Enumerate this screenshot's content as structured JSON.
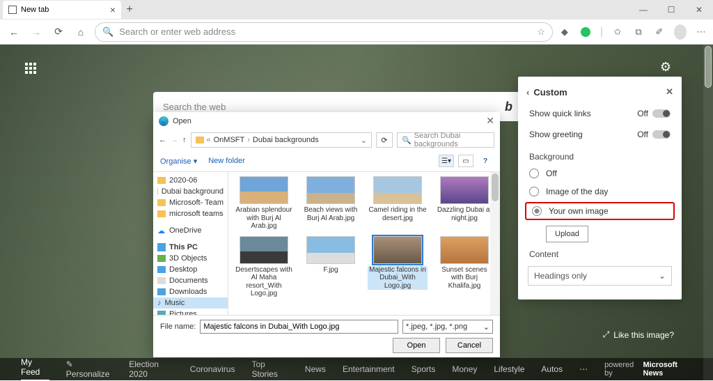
{
  "browser": {
    "tab_title": "New tab",
    "address_placeholder": "Search or enter web address"
  },
  "ntp": {
    "search_placeholder": "Search the web",
    "like_label": "Like this image?",
    "feed": [
      "My Feed",
      "Personalize",
      "Election 2020",
      "Coronavirus",
      "Top Stories",
      "News",
      "Entertainment",
      "Sports",
      "Money",
      "Lifestyle",
      "Autos"
    ],
    "powered": "powered by",
    "brand": "Microsoft News"
  },
  "panel": {
    "title": "Custom",
    "quick_links": {
      "label": "Show quick links",
      "state": "Off"
    },
    "greeting": {
      "label": "Show greeting",
      "state": "Off"
    },
    "background_label": "Background",
    "bg_off": "Off",
    "bg_image": "Image of the day",
    "bg_own": "Your own image",
    "upload": "Upload",
    "content_label": "Content",
    "content_value": "Headings only"
  },
  "dialog": {
    "title": "Open",
    "path": {
      "seg1": "OnMSFT",
      "seg2": "Dubai backgrounds",
      "prefix": "«"
    },
    "search_placeholder": "Search Dubai backgrounds",
    "organise": "Organise",
    "newfolder": "New folder",
    "tree": {
      "folders": [
        "2020-06",
        "Dubai background",
        "Microsoft- Team",
        "microsoft teams"
      ],
      "onedrive": "OneDrive",
      "thispc": "This PC",
      "pcitems": [
        "3D Objects",
        "Desktop",
        "Documents",
        "Downloads",
        "Music",
        "Pictures"
      ]
    },
    "files": [
      {
        "cap": "Arabian splendour with Burj Al Arab.jpg"
      },
      {
        "cap": "Beach views with Burj Al Arab.jpg"
      },
      {
        "cap": "Camel riding in the desert.jpg"
      },
      {
        "cap": "Dazzling Dubai at night.jpg"
      },
      {
        "cap": "Desertscapes with Al Maha resort_With Logo.jpg"
      },
      {
        "cap": "F.jpg"
      },
      {
        "cap": "Majestic falcons in Dubai_With Logo.jpg"
      },
      {
        "cap": "Sunset scenes with Burj Khalifa.jpg"
      }
    ],
    "filename_label": "File name:",
    "filename_value": "Majestic falcons in Dubai_With Logo.jpg",
    "filetype": "*.jpeg, *.jpg, *.png",
    "open": "Open",
    "cancel": "Cancel"
  }
}
